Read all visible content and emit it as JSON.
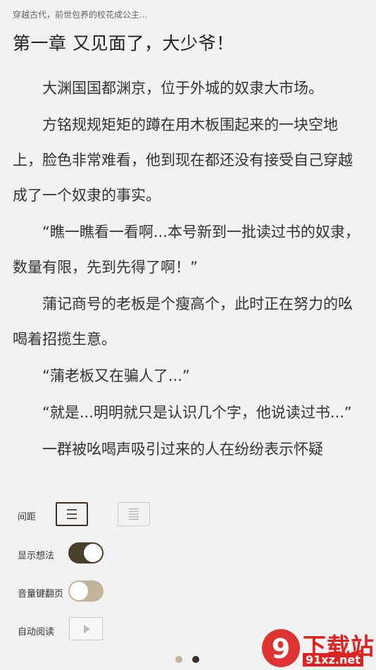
{
  "reader": {
    "book_title": "穿越古代，前世包养的校花成公主...",
    "chapter_title": "第一章 又见面了，大少爷！",
    "paragraphs": [
      "大渊国国都渊京，位于外城的奴隶大市场。",
      "方铭规规矩矩的蹲在用木板围起来的一块空地上，脸色非常难看，他到现在都还没有接受自己穿越成了一个奴隶的事实。",
      "“瞧一瞧看一看啊...本号新到一批读过书的奴隶，数量有限，先到先得了啊！”",
      "蒲记商号的老板是个瘦高个，此时正在努力的吆喝着招揽生意。",
      "“蒲老板又在骗人了...”",
      "“就是...明明就只是认识几个字，他说读过书...”",
      "一群被吆喝声吸引过来的人在纷纷表示怀疑"
    ]
  },
  "settings": {
    "spacing_label": "间距",
    "show_thoughts_label": "显示想法",
    "show_thoughts_on": true,
    "volume_key_label": "音量键翻页",
    "volume_key_on": false,
    "auto_read_label": "自动阅读",
    "page_count": 2,
    "active_page": 2
  },
  "watermark": {
    "badge": "9",
    "title": "下载站",
    "domain": "91xz.net"
  },
  "colors": {
    "accent_dark": "#4a3f2f",
    "accent_light": "#c2b49a",
    "watermark_red": "#dd2222"
  }
}
